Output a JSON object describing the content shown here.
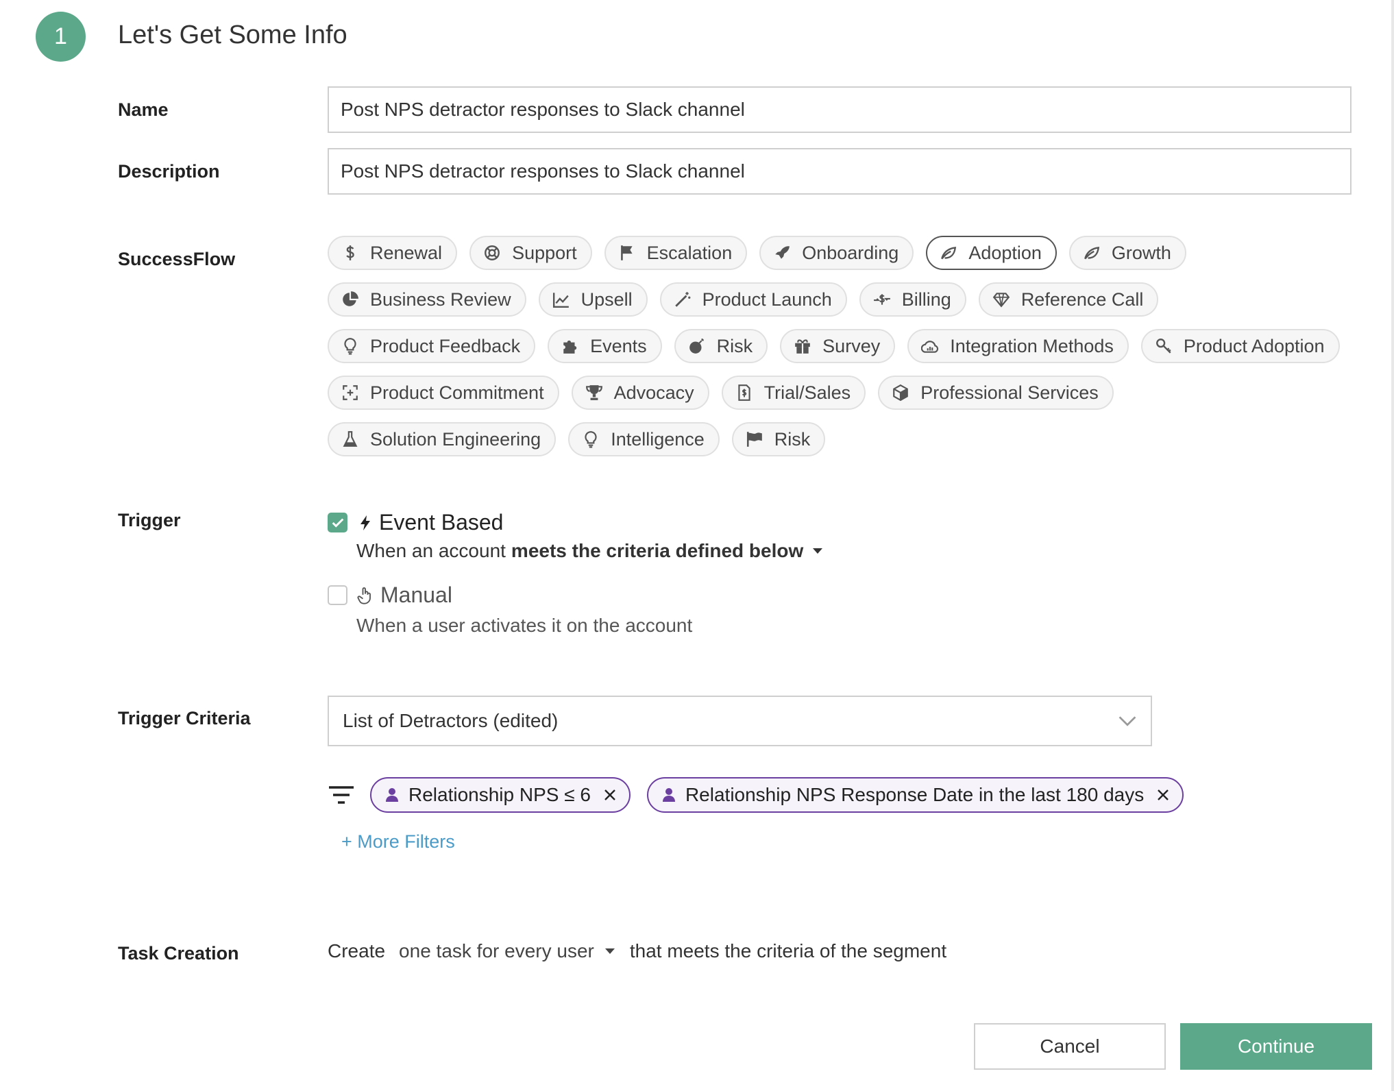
{
  "step": {
    "number": "1",
    "title": "Let's Get Some Info"
  },
  "labels": {
    "name": "Name",
    "description": "Description",
    "successflow": "SuccessFlow",
    "trigger": "Trigger",
    "trigger_criteria": "Trigger Criteria",
    "task_creation": "Task Creation"
  },
  "name_field": {
    "value": "Post NPS detractor responses to Slack channel"
  },
  "description_field": {
    "value": "Post NPS detractor responses to Slack channel"
  },
  "chips": {
    "row1": [
      {
        "label": "Renewal",
        "icon": "dollar-icon"
      },
      {
        "label": "Support",
        "icon": "lifebuoy-icon"
      },
      {
        "label": "Escalation",
        "icon": "flag-icon"
      },
      {
        "label": "Onboarding",
        "icon": "rocket-icon"
      },
      {
        "label": "Adoption",
        "icon": "leaf-icon",
        "selected": true
      },
      {
        "label": "Growth",
        "icon": "leaf-icon"
      }
    ],
    "row2": [
      {
        "label": "Business Review",
        "icon": "pie-chart-icon"
      },
      {
        "label": "Upsell",
        "icon": "line-chart-icon"
      },
      {
        "label": "Product Launch",
        "icon": "magic-wand-icon"
      },
      {
        "label": "Billing",
        "icon": "money-transfer-icon"
      },
      {
        "label": "Reference Call",
        "icon": "diamond-icon"
      }
    ],
    "row3": [
      {
        "label": "Product Feedback",
        "icon": "lightbulb-icon"
      },
      {
        "label": "Events",
        "icon": "puzzle-icon"
      },
      {
        "label": "Risk",
        "icon": "bomb-icon"
      },
      {
        "label": "Survey",
        "icon": "gift-icon"
      },
      {
        "label": "Integration Methods",
        "icon": "cloud-chart-icon"
      },
      {
        "label": "Product Adoption",
        "icon": "key-icon"
      }
    ],
    "row4": [
      {
        "label": "Product Commitment",
        "icon": "frame-plus-icon"
      },
      {
        "label": "Advocacy",
        "icon": "trophy-icon"
      },
      {
        "label": "Trial/Sales",
        "icon": "dollar-file-icon"
      },
      {
        "label": "Professional Services",
        "icon": "box-icon"
      }
    ],
    "row5": [
      {
        "label": "Solution Engineering",
        "icon": "flask-icon"
      },
      {
        "label": "Intelligence",
        "icon": "lightbulb-icon"
      },
      {
        "label": "Risk",
        "icon": "flag-wave-icon"
      }
    ]
  },
  "trigger": {
    "event_based": {
      "label": "Event Based",
      "checked": true,
      "desc_prefix": "When an account",
      "desc_bold": "meets the criteria defined below"
    },
    "manual": {
      "label": "Manual",
      "checked": false,
      "desc": "When a user activates it on the account"
    }
  },
  "criteria": {
    "selected": "List of Detractors (edited)",
    "filters": [
      {
        "label": "Relationship NPS ≤ 6"
      },
      {
        "label": "Relationship NPS Response Date in the last 180 days"
      }
    ],
    "more_filters": "+ More Filters"
  },
  "task_creation": {
    "prefix": "Create",
    "option": "one task for every user",
    "suffix": "that meets the criteria of the segment"
  },
  "buttons": {
    "cancel": "Cancel",
    "continue": "Continue"
  },
  "colors": {
    "accent": "#5ba88a",
    "filter_border": "#6b3fa0",
    "link": "#4a9bc8"
  }
}
